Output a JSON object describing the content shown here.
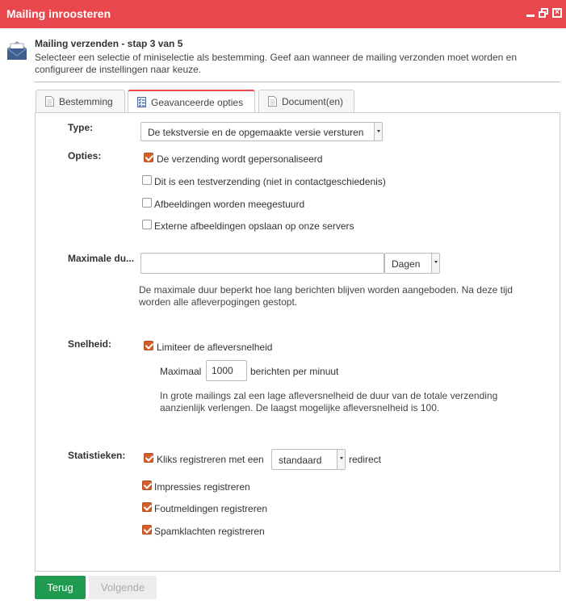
{
  "window": {
    "title": "Mailing inroosteren",
    "minimize_icon": "minimize-icon",
    "maximize_icon": "restore-icon",
    "close_icon": "close-icon",
    "close_glyph": "×"
  },
  "header": {
    "icon": "envelope-icon",
    "step_title": "Mailing verzenden - stap 3 van 5",
    "description": "Selecteer een selectie of miniselectie als bestemming. Geef aan wanneer de mailing verzonden moet worden en configureer de instellingen naar keuze."
  },
  "tabs": [
    {
      "label": "Bestemming",
      "icon": "document-icon",
      "active": false
    },
    {
      "label": "Geavanceerde opties",
      "icon": "checklist-icon",
      "active": true
    },
    {
      "label": "Document(en)",
      "icon": "document-icon",
      "active": false
    }
  ],
  "form": {
    "type": {
      "label": "Type:",
      "selected": "De tekstversie en de opgemaakte versie versturen"
    },
    "options": {
      "label": "Opties:",
      "items": [
        {
          "label": "De verzending wordt gepersonaliseerd",
          "checked": true
        },
        {
          "label": "Dit is een testverzending (niet in contactgeschiedenis)",
          "checked": false
        },
        {
          "label": "Afbeeldingen worden meegestuurd",
          "checked": false
        },
        {
          "label": "Externe afbeeldingen opslaan op onze servers",
          "checked": false
        }
      ]
    },
    "max_duration": {
      "label": "Maximale du...",
      "value": "",
      "unit": "Dagen",
      "note": "De maximale duur beperkt hoe lang berichten blijven worden aangeboden. Na deze tijd worden alle afleverpogingen gestopt."
    },
    "speed": {
      "label": "Snelheid:",
      "limit_label": "Limiteer de afleversnelheid",
      "limit_checked": true,
      "max_prefix": "Maximaal",
      "max_value": "1000",
      "max_suffix": "berichten per minuut",
      "note": "In grote mailings zal een lage afleversnelheid de duur van de totale verzending aanzienlijk verlengen. De laagst mogelijke afleversnelheid is 100."
    },
    "statistics": {
      "label": "Statistieken:",
      "clicks_prefix": "Kliks registreren met een",
      "clicks_checked": true,
      "redirect_selected": "standaard",
      "clicks_suffix": "redirect",
      "items": [
        {
          "label": "Impressies registreren",
          "checked": true
        },
        {
          "label": "Foutmeldingen registreren",
          "checked": true
        },
        {
          "label": "Spamklachten registreren",
          "checked": true
        }
      ]
    }
  },
  "footer": {
    "back_label": "Terug",
    "next_label": "Volgende"
  },
  "colors": {
    "titlebar": "#e8484d",
    "checkbox_checked": "#d35f2d",
    "primary_button": "#1f9a50"
  }
}
